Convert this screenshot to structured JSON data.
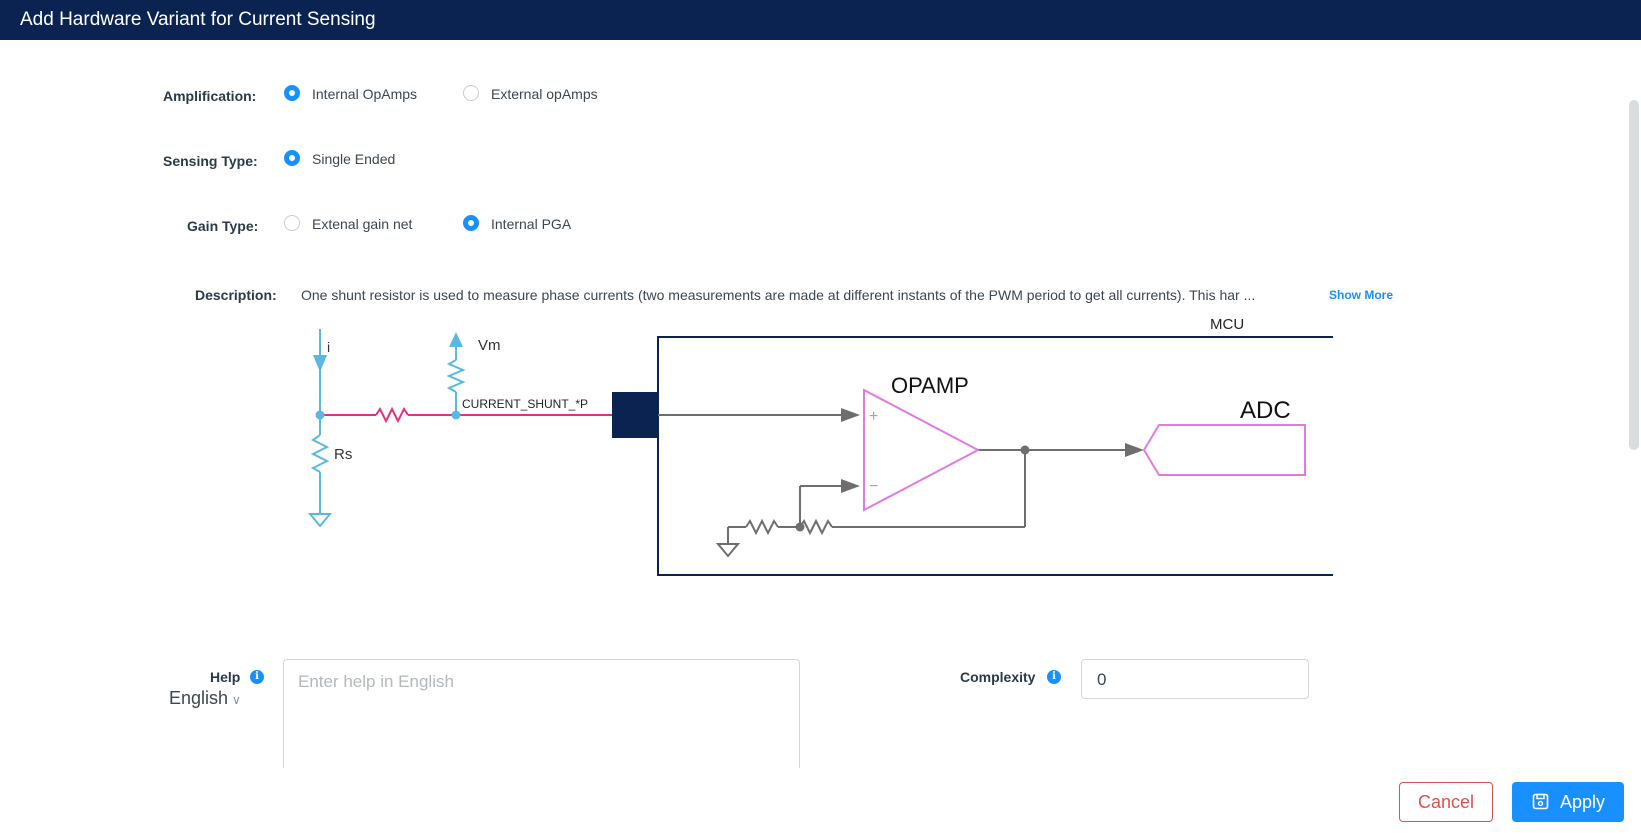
{
  "dialog": {
    "title": "Add Hardware Variant for Current Sensing"
  },
  "amplification": {
    "label": "Amplification:",
    "options": [
      "Internal OpAmps",
      "External opAmps"
    ],
    "selected": "Internal OpAmps"
  },
  "sensing_type": {
    "label": "Sensing Type:",
    "options": [
      "Single Ended"
    ],
    "selected": "Single Ended"
  },
  "gain_type": {
    "label": "Gain Type:",
    "options": [
      "Extenal gain net",
      "Internal PGA"
    ],
    "selected": "Internal PGA"
  },
  "description": {
    "label": "Description:",
    "text": "One shunt resistor is used to measure phase currents (two measurements are made at different instants of the PWM period to get all currents). This har ...",
    "show_more": "Show More"
  },
  "diagram": {
    "current_label": "i",
    "supply_label": "Vm",
    "shunt_label": "Rs",
    "net_label": "CURRENT_SHUNT_*P",
    "mcu_label": "MCU",
    "opamp_label": "OPAMP",
    "adc_label": "ADC",
    "plus_sign": "+",
    "minus_sign": "−",
    "colors": {
      "circuit": "#5bb8e0",
      "net": "#e0337d",
      "mcu": "#0b2350",
      "opamp": "#e07be0",
      "wire": "#6e6e6e"
    }
  },
  "help": {
    "label": "Help",
    "info": "i",
    "language": "English",
    "placeholder": "Enter help in English"
  },
  "complexity": {
    "label": "Complexity",
    "info": "i",
    "value": "0"
  },
  "footer": {
    "cancel": "Cancel",
    "apply": "Apply"
  },
  "colors": {
    "title_bg": "#0b2350",
    "accent": "#1890ff",
    "danger": "#d9534f"
  }
}
